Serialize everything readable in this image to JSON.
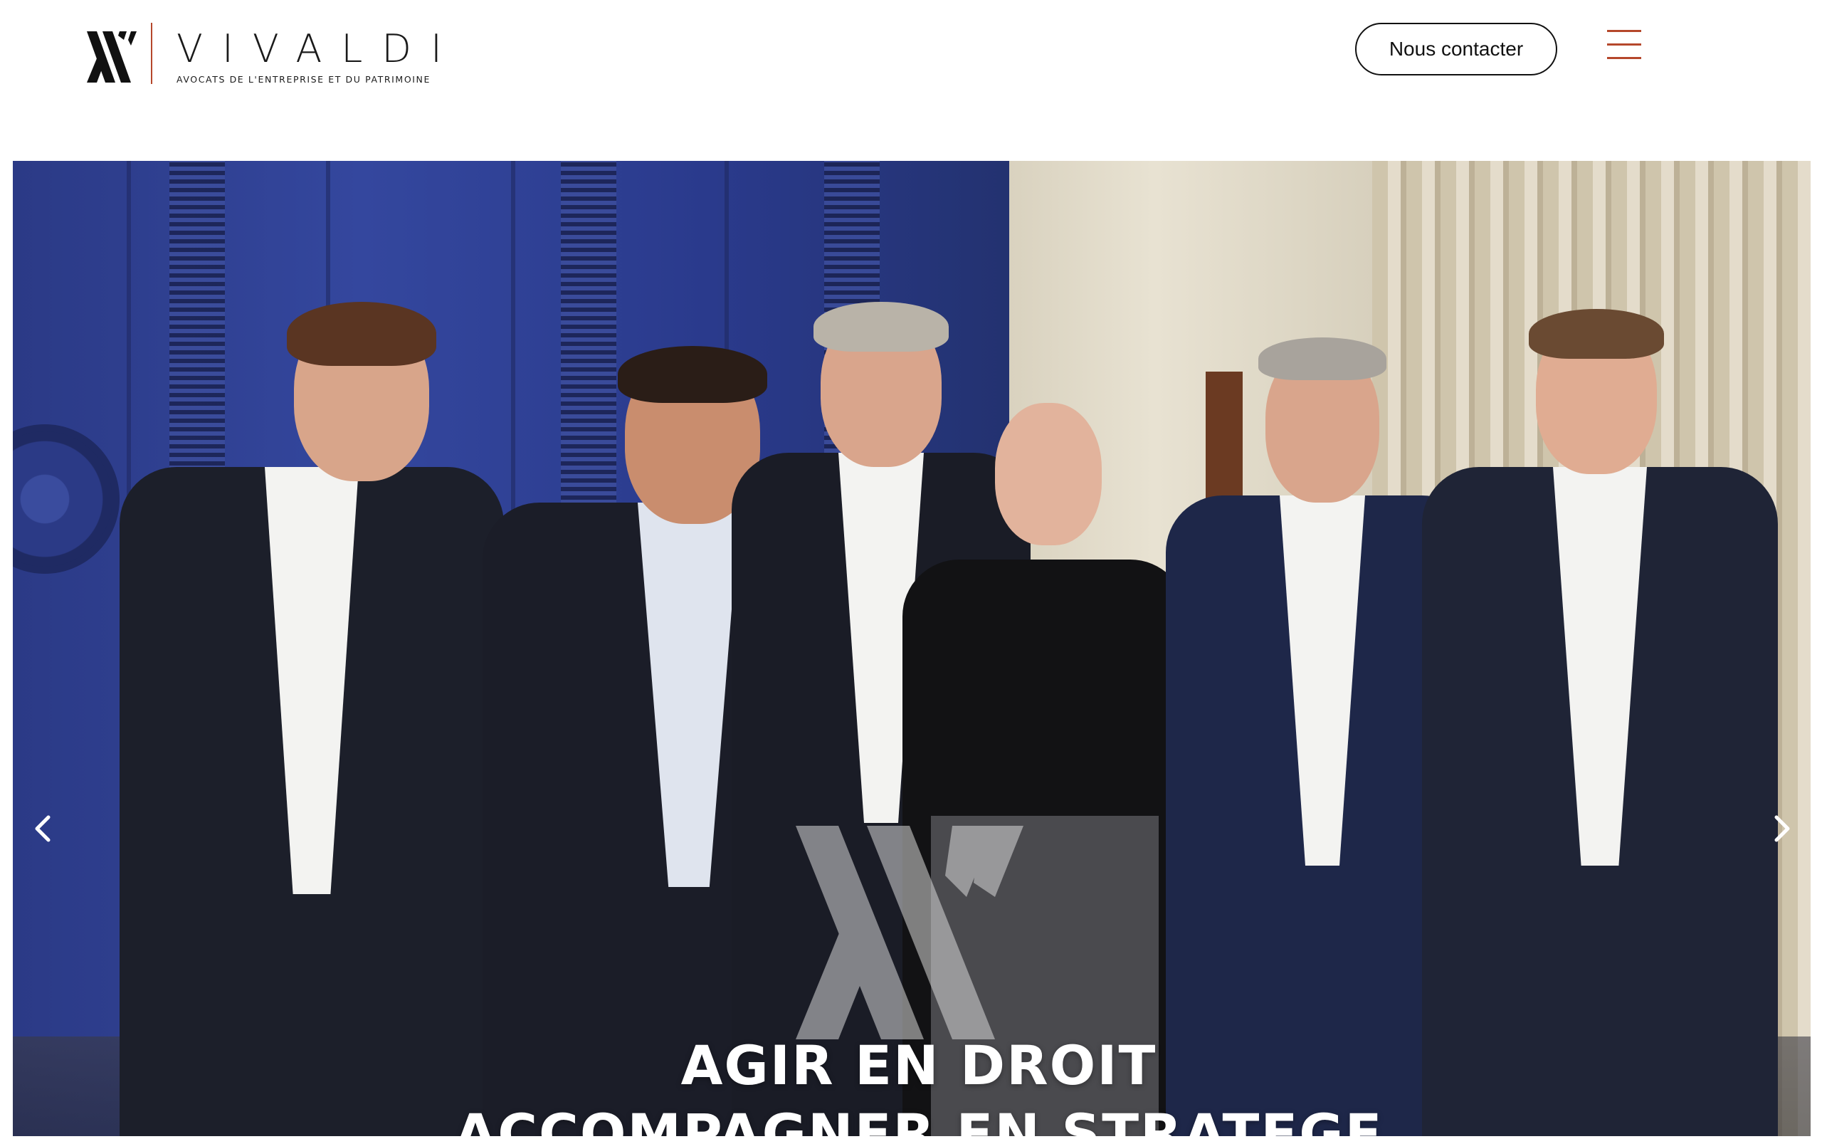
{
  "header": {
    "brand_name": "VIVALDI",
    "brand_tagline": "AVOCATS DE L'ENTREPRISE ET DU PATRIMOINE",
    "contact_label": "Nous contacter",
    "menu_icon": "hamburger-menu-icon"
  },
  "colors": {
    "accent": "#b5472b",
    "text": "#111111",
    "background": "#ffffff"
  },
  "hero": {
    "slogan_line1": "AGIR EN DROIT",
    "slogan_line2": "ACCOMPAGNER EN STRATEGE",
    "prev_icon": "chevron-left-icon",
    "next_icon": "chevron-right-icon"
  }
}
